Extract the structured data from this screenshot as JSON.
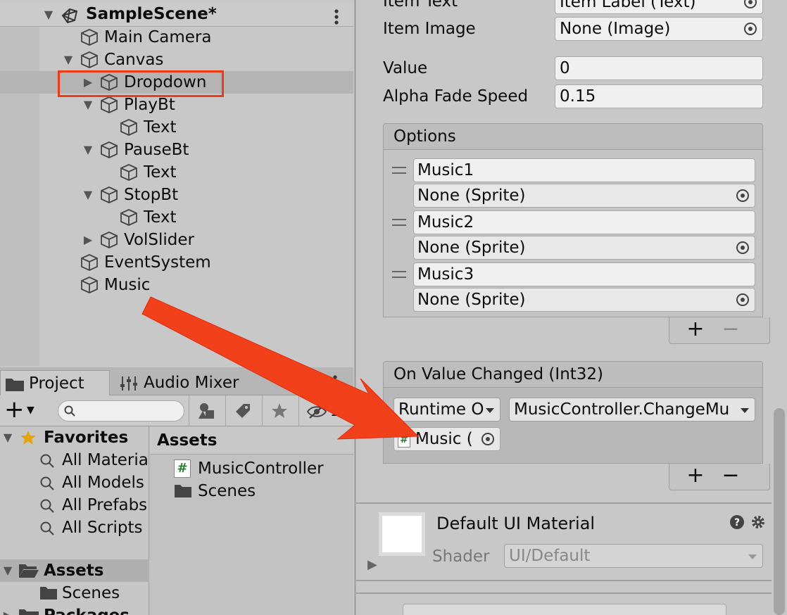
{
  "hierarchy": {
    "scene_name": "SampleScene*",
    "items": [
      {
        "label": "Main Camera"
      },
      {
        "label": "Canvas"
      },
      {
        "label": "Dropdown"
      },
      {
        "label": "PlayBt"
      },
      {
        "label": "Text"
      },
      {
        "label": "PauseBt"
      },
      {
        "label": "Text"
      },
      {
        "label": "StopBt"
      },
      {
        "label": "Text"
      },
      {
        "label": "VolSlider"
      },
      {
        "label": "EventSystem"
      },
      {
        "label": "Music"
      }
    ]
  },
  "project": {
    "tabs": [
      {
        "label": "Project"
      },
      {
        "label": "Audio Mixer"
      }
    ],
    "toolbar_count": "17",
    "favorites_label": "Favorites",
    "favorites": [
      {
        "label": "All Materia"
      },
      {
        "label": "All Models"
      },
      {
        "label": "All Prefabs"
      },
      {
        "label": "All Scripts"
      }
    ],
    "assets_label": "Assets",
    "scenes_label": "Scenes",
    "packages_label": "Packages",
    "breadcrumb": "Assets",
    "files": [
      {
        "label": "MusicController"
      },
      {
        "label": "Scenes"
      }
    ]
  },
  "inspector": {
    "item_text_label": "Item Text",
    "item_text_value": "Item Label (Text)",
    "item_image_label": "Item Image",
    "item_image_value": "None (Image)",
    "value_label": "Value",
    "value_value": "0",
    "alpha_label": "Alpha Fade Speed",
    "alpha_value": "0.15",
    "options_label": "Options",
    "options": [
      {
        "text": "Music1",
        "sprite": "None (Sprite)"
      },
      {
        "text": "Music2",
        "sprite": "None (Sprite)"
      },
      {
        "text": "Music3",
        "sprite": "None (Sprite)"
      }
    ],
    "plus": "+",
    "minus": "−",
    "on_value_changed_label": "On Value Changed (Int32)",
    "runtime_value": "Runtime O",
    "function_value": "MusicController.ChangeMu",
    "object_value": "Music (",
    "material_title": "Default UI Material",
    "shader_label": "Shader",
    "shader_value": "UI/Default"
  }
}
